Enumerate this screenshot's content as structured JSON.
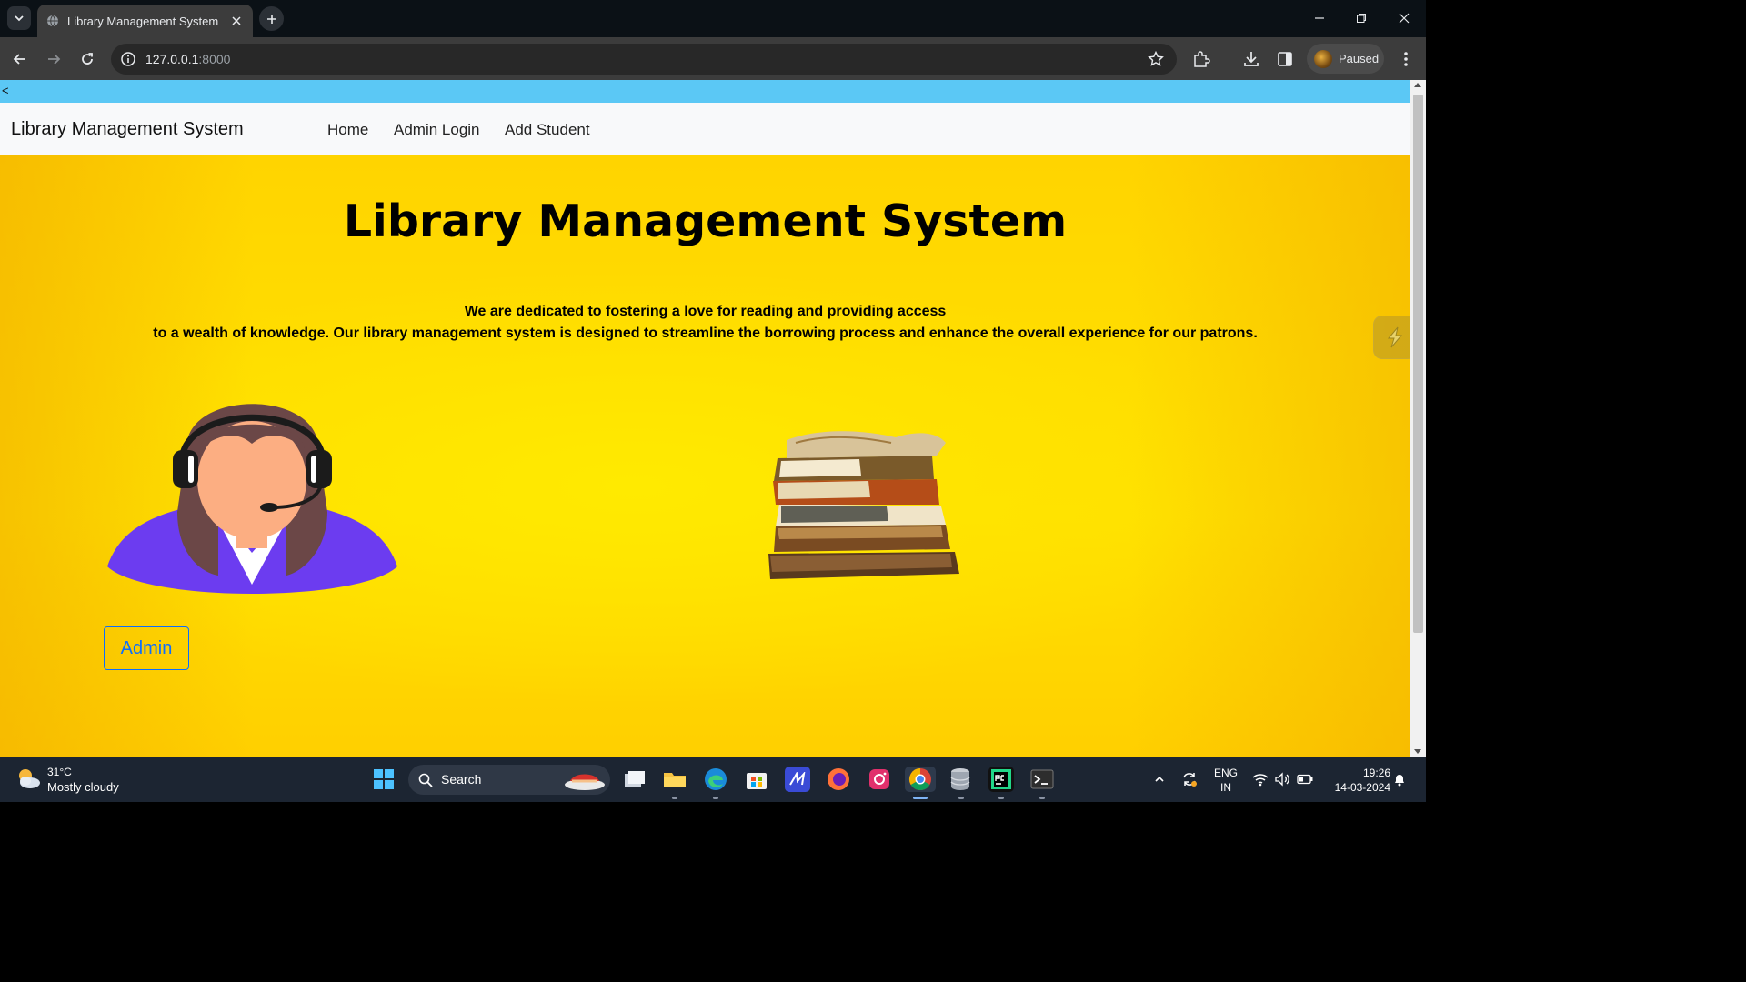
{
  "browser": {
    "tab_title": "Library Management System",
    "url_host": "127.0.0.1",
    "url_port": ":8000",
    "profile_status": "Paused"
  },
  "page": {
    "top_bar_text": "<",
    "navbar": {
      "brand": "Library Management System",
      "links": [
        "Home",
        "Admin Login",
        "Add Student"
      ]
    },
    "hero": {
      "heading": "Library Management System",
      "description_line1": "We are dedicated to fostering a love for reading and providing access",
      "description_line2": "to a wealth of knowledge. Our library management system is designed to streamline the borrowing process and enhance the overall experience for our patrons.",
      "admin_button": "Admin"
    },
    "colors": {
      "hero_background": "#ffdd00",
      "top_bar": "#5bc8f5",
      "button_accent": "#0d6efd"
    }
  },
  "taskbar": {
    "weather_temp": "31°C",
    "weather_desc": "Mostly cloudy",
    "search_label": "Search",
    "language_line1": "ENG",
    "language_line2": "IN",
    "time": "19:26",
    "date": "14-03-2024"
  }
}
